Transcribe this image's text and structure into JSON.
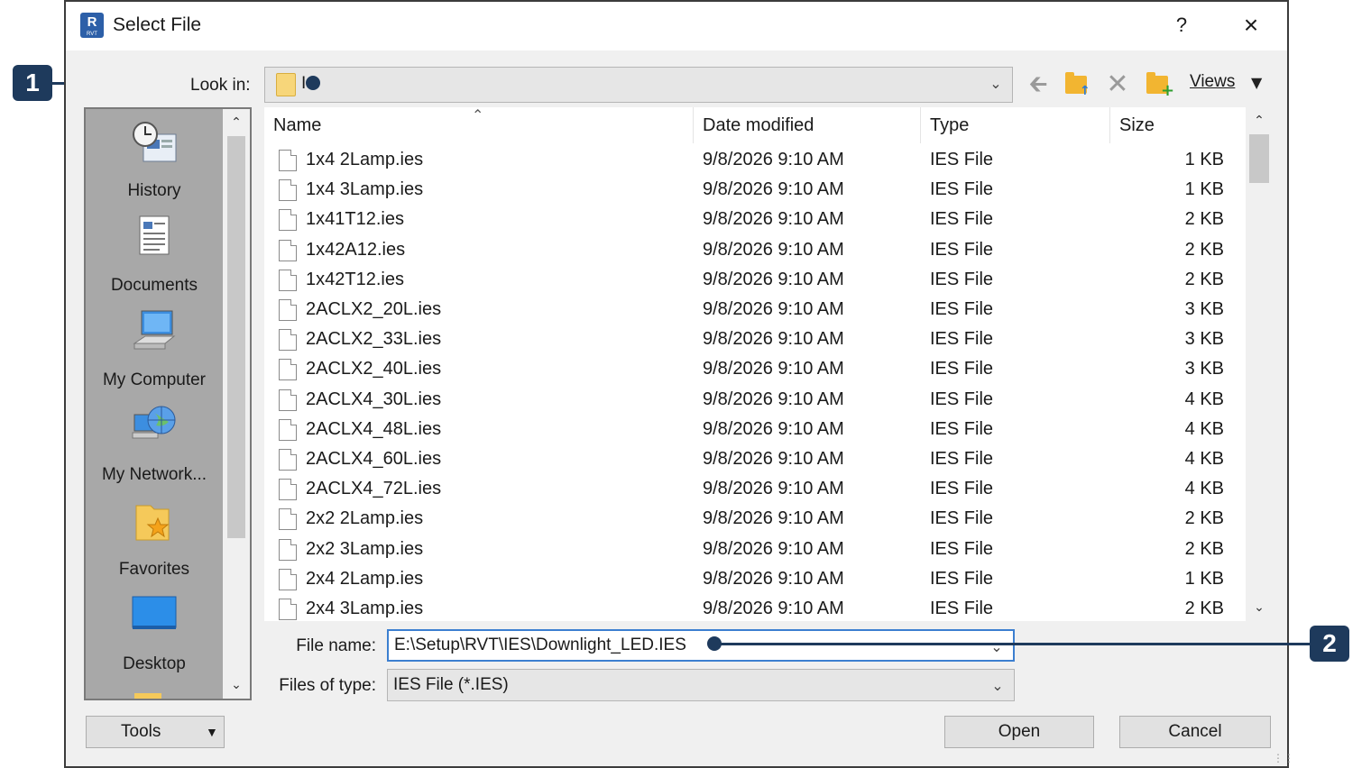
{
  "window": {
    "title": "Select File",
    "app_icon_letter": "R",
    "app_icon_sub": "RVT",
    "help": "?",
    "close": "×"
  },
  "toolbar": {
    "look_in_label": "Look in:",
    "look_in_value": "I",
    "views_label": "Views",
    "back_icon": "back-arrow-icon",
    "delete_icon": "delete-icon"
  },
  "places": [
    {
      "label": "History",
      "icon": "history-icon"
    },
    {
      "label": "Documents",
      "icon": "documents-icon"
    },
    {
      "label": "My Computer",
      "icon": "my-computer-icon"
    },
    {
      "label": "My Network...",
      "icon": "network-icon"
    },
    {
      "label": "Favorites",
      "icon": "favorites-icon"
    },
    {
      "label": "Desktop",
      "icon": "desktop-icon"
    }
  ],
  "columns": {
    "name": "Name",
    "date": "Date modified",
    "type": "Type",
    "size": "Size"
  },
  "files": [
    {
      "name": "1x4 2Lamp.ies",
      "date": "9/8/2026 9:10 AM",
      "type": "IES File",
      "size": "1 KB"
    },
    {
      "name": "1x4 3Lamp.ies",
      "date": "9/8/2026 9:10 AM",
      "type": "IES File",
      "size": "1 KB"
    },
    {
      "name": "1x41T12.ies",
      "date": "9/8/2026 9:10 AM",
      "type": "IES File",
      "size": "2 KB"
    },
    {
      "name": "1x42A12.ies",
      "date": "9/8/2026 9:10 AM",
      "type": "IES File",
      "size": "2 KB"
    },
    {
      "name": "1x42T12.ies",
      "date": "9/8/2026 9:10 AM",
      "type": "IES File",
      "size": "2 KB"
    },
    {
      "name": "2ACLX2_20L.ies",
      "date": "9/8/2026 9:10 AM",
      "type": "IES File",
      "size": "3 KB"
    },
    {
      "name": "2ACLX2_33L.ies",
      "date": "9/8/2026 9:10 AM",
      "type": "IES File",
      "size": "3 KB"
    },
    {
      "name": "2ACLX2_40L.ies",
      "date": "9/8/2026 9:10 AM",
      "type": "IES File",
      "size": "3 KB"
    },
    {
      "name": "2ACLX4_30L.ies",
      "date": "9/8/2026 9:10 AM",
      "type": "IES File",
      "size": "4 KB"
    },
    {
      "name": "2ACLX4_48L.ies",
      "date": "9/8/2026 9:10 AM",
      "type": "IES File",
      "size": "4 KB"
    },
    {
      "name": "2ACLX4_60L.ies",
      "date": "9/8/2026 9:10 AM",
      "type": "IES File",
      "size": "4 KB"
    },
    {
      "name": "2ACLX4_72L.ies",
      "date": "9/8/2026 9:10 AM",
      "type": "IES File",
      "size": "4 KB"
    },
    {
      "name": "2x2 2Lamp.ies",
      "date": "9/8/2026 9:10 AM",
      "type": "IES File",
      "size": "2 KB"
    },
    {
      "name": "2x2 3Lamp.ies",
      "date": "9/8/2026 9:10 AM",
      "type": "IES File",
      "size": "2 KB"
    },
    {
      "name": "2x4 2Lamp.ies",
      "date": "9/8/2026 9:10 AM",
      "type": "IES File",
      "size": "1 KB"
    },
    {
      "name": "2x4 3Lamp.ies",
      "date": "9/8/2026 9:10 AM",
      "type": "IES File",
      "size": "2 KB"
    }
  ],
  "form": {
    "file_name_label": "File name:",
    "file_name_value": "E:\\Setup\\RVT\\IES\\Downlight_LED.IES",
    "file_type_label": "Files of type:",
    "file_type_value": "IES File (*.IES)"
  },
  "buttons": {
    "tools": "Tools",
    "open": "Open",
    "cancel": "Cancel"
  },
  "callouts": [
    "1",
    "2"
  ],
  "colors": {
    "callout": "#1e3a5c",
    "focus": "#3c7fd0",
    "folder": "#f2b531"
  }
}
